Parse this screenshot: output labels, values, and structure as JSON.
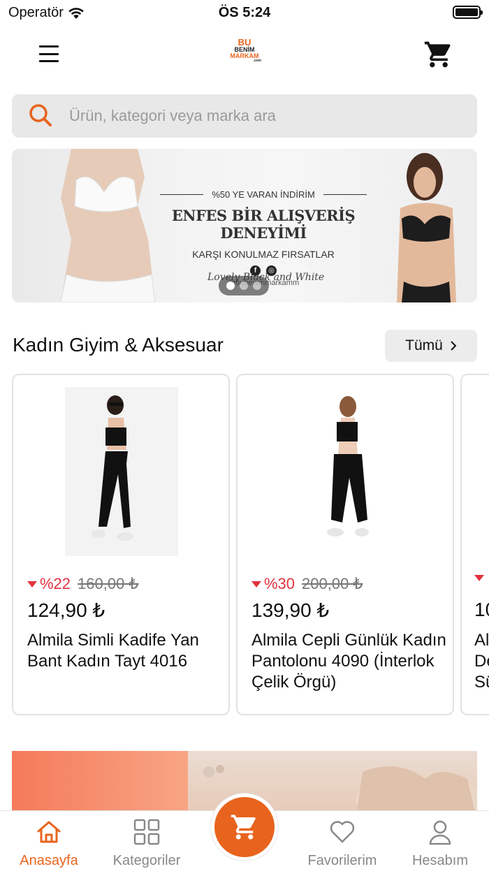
{
  "status_bar": {
    "carrier": "Operatör",
    "time": "ÖS 5:24"
  },
  "header": {
    "logo": {
      "line1": "BU",
      "line2": "BENİM",
      "line3": "MARKAM",
      "line4": ".com"
    }
  },
  "search": {
    "placeholder": "Ürün, kategori veya marka ara"
  },
  "banner": {
    "promo_line": "%50 YE VARAN İNDİRİM",
    "title": "ENFES BİR ALIŞVERİŞ DENEYİMİ",
    "subtitle": "KARŞI KONULMAZ FIRSATLAR",
    "social_icons": [
      "facebook-icon",
      "instagram-icon"
    ],
    "handle": "@bubenimmarkamm",
    "script_text": "Lovely Black and White"
  },
  "section": {
    "title": "Kadın Giyim & Aksesuar",
    "see_all_label": "Tümü",
    "see_all_icon": "chevron-right-icon"
  },
  "products": [
    {
      "discount": "%22",
      "old_price": "160,00 ₺",
      "price": "124,90 ₺",
      "name": "Almila Simli Kadife Yan Bant Kadın Tayt 4016"
    },
    {
      "discount": "%30",
      "old_price": "200,00 ₺",
      "price": "139,90 ₺",
      "name": "Almila Cepli Günlük Kadın Pantolonu 4090 (İnterlok Çelik Örgü)"
    },
    {
      "discount": "",
      "old_price": "",
      "price": "10",
      "name": "Al De Sü"
    }
  ],
  "tab_bar": {
    "tabs": [
      {
        "label": "Anasayfa",
        "icon": "home-icon",
        "active": true
      },
      {
        "label": "Kategoriler",
        "icon": "grid-icon",
        "active": false
      },
      {
        "label": "Favorilerim",
        "icon": "heart-icon",
        "active": false
      },
      {
        "label": "Hesabım",
        "icon": "user-icon",
        "active": false
      }
    ],
    "center_icon": "cart-icon"
  },
  "colors": {
    "accent": "#e8641e",
    "discount_red": "#e2323f",
    "inactive_tab": "#888888"
  }
}
